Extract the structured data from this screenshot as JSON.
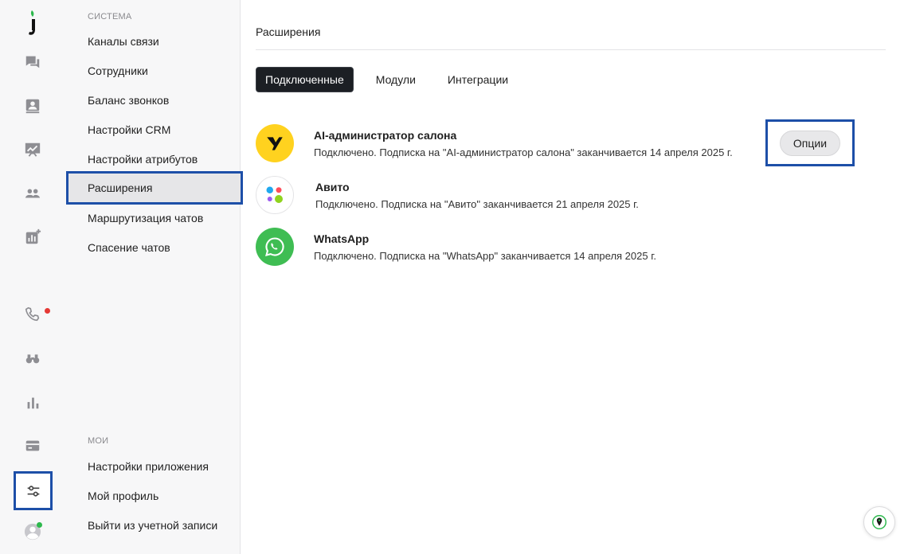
{
  "nav": {
    "section_system": "СИСТЕМА",
    "system_items": [
      {
        "label": "Каналы связи"
      },
      {
        "label": "Сотрудники"
      },
      {
        "label": "Баланс звонков"
      },
      {
        "label": "Настройки CRM"
      },
      {
        "label": "Настройки атрибутов"
      },
      {
        "label": "Расширения"
      },
      {
        "label": "Маршрутизация чатов"
      },
      {
        "label": "Спасение чатов"
      }
    ],
    "selected": "Расширения",
    "section_mine": "МОИ",
    "mine_items": [
      {
        "label": "Настройки приложения"
      },
      {
        "label": "Мой профиль"
      },
      {
        "label": "Выйти из учетной записи"
      }
    ]
  },
  "rail": {
    "icons": [
      "logo-icon",
      "chats-icon",
      "contacts-icon",
      "analytics-board-icon",
      "team-icon",
      "reports-add-icon",
      "phone-icon",
      "binoculars-icon",
      "stats-icon",
      "billing-card-icon",
      "settings-sliders-icon",
      "avatar-icon"
    ],
    "active": "settings-sliders-icon",
    "phone_badge_color": "#e53935",
    "avatar_status_color": "#2db84d"
  },
  "main": {
    "title": "Расширения",
    "tabs": [
      {
        "label": "Подключенные",
        "active": true
      },
      {
        "label": "Модули",
        "active": false
      },
      {
        "label": "Интеграции",
        "active": false
      }
    ],
    "extensions": [
      {
        "name": "AI-администратор салона",
        "status": "Подключено. Подписка на \"AI-администратор салона\" заканчивается 14 апреля 2025 г.",
        "icon": "ai-admin-logo-icon",
        "color": "#ffd21f"
      },
      {
        "name": "Авито",
        "status": "Подключено. Подписка на \"Авито\" заканчивается 21 апреля 2025 г.",
        "icon": "avito-logo-icon",
        "color": "#ffffff"
      },
      {
        "name": "WhatsApp",
        "status": "Подключено. Подписка на \"WhatsApp\" заканчивается 14 апреля 2025 г.",
        "icon": "whatsapp-logo-icon",
        "color": "#3fbd53"
      }
    ],
    "options_label": "Опции"
  },
  "colors": {
    "highlight": "#1d4fa8",
    "active_tab": "#1c1f24",
    "rail_icon": "#8e8e93"
  }
}
